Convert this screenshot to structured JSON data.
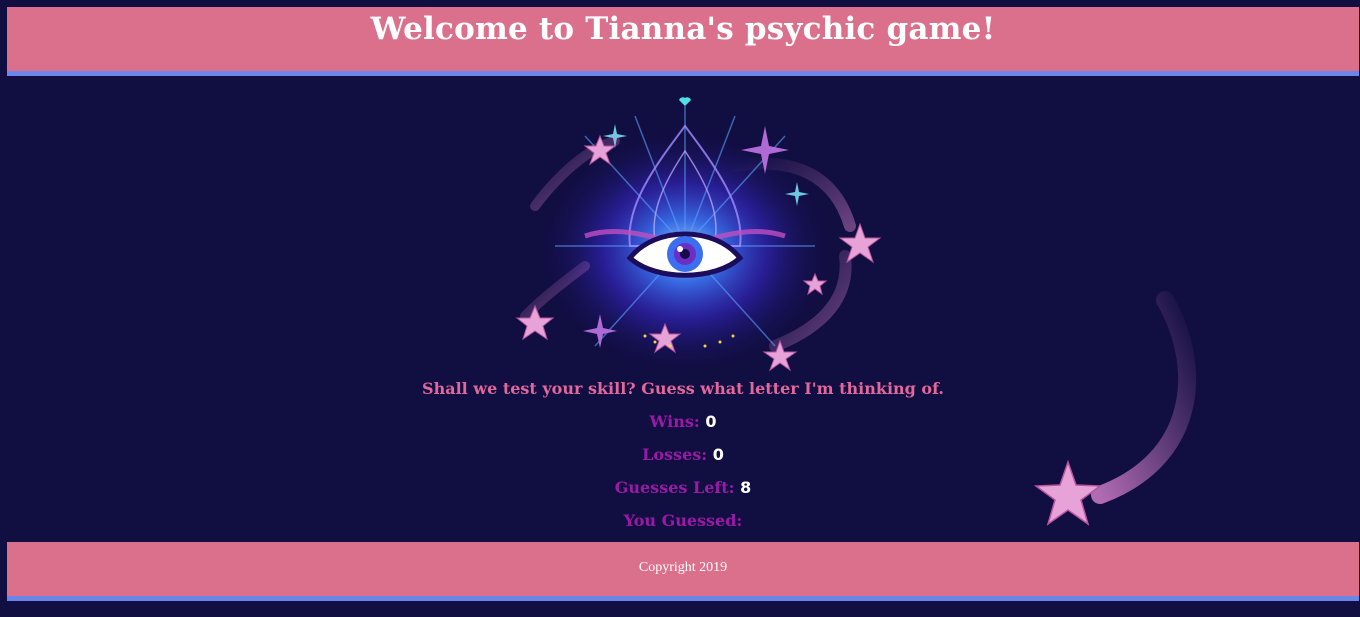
{
  "header": {
    "title": "Welcome to Tianna's psychic game!"
  },
  "art": {
    "icon": "third-eye-mystic-illustration",
    "comet_icon": "shooting-star-icon"
  },
  "game": {
    "prompt": "Shall we test your skill? Guess what letter I'm thinking of.",
    "wins_label": "Wins:",
    "wins_value": "0",
    "losses_label": "Losses:",
    "losses_value": "0",
    "guesses_left_label": "Guesses Left:",
    "guesses_left_value": "8",
    "you_guessed_label": "You Guessed:",
    "you_guessed_value": ""
  },
  "footer": {
    "copyright": "Copyright 2019"
  },
  "colors": {
    "background": "#110e42",
    "bar": "#db708c",
    "bar_border": "#6b86e8",
    "prompt": "#e2679a",
    "label": "#9a1aa6"
  }
}
